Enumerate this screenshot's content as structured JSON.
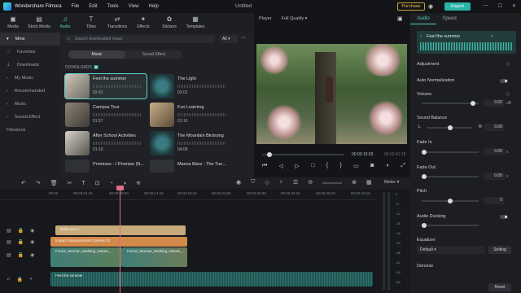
{
  "titlebar": {
    "app": "Wondershare Filmora",
    "menus": [
      "File",
      "Edit",
      "Tools",
      "View",
      "Help"
    ],
    "doc": "Untitled",
    "purchase": "Purchase",
    "export": "Export"
  },
  "media_tabs": [
    {
      "label": "Media",
      "icon": "media-icon"
    },
    {
      "label": "Stock Media",
      "icon": "stock-media-icon"
    },
    {
      "label": "Audio",
      "icon": "audio-icon"
    },
    {
      "label": "Titles",
      "icon": "titles-icon"
    },
    {
      "label": "Transitions",
      "icon": "transitions-icon"
    },
    {
      "label": "Effects",
      "icon": "effects-icon"
    },
    {
      "label": "Stickers",
      "icon": "stickers-icon"
    },
    {
      "label": "Templates",
      "icon": "templates-icon"
    }
  ],
  "sidebar": {
    "items": [
      "Mine",
      "Favorites",
      "Downloads",
      "My Music",
      "Recommended",
      "Music",
      "Sound Effect",
      "Filmstock"
    ]
  },
  "library": {
    "search_placeholder": "Search downloaded music",
    "filter": "All",
    "segments": [
      "Music",
      "Sound Effect"
    ],
    "section": "DOWNLOADS",
    "section_count": "8",
    "tracks": [
      {
        "name": "Feel the summer",
        "dur": "02:41"
      },
      {
        "name": "The Light",
        "dur": "03:01"
      },
      {
        "name": "Campus Tour",
        "dur": "01:57"
      },
      {
        "name": "Fun Learning",
        "dur": "01:16"
      },
      {
        "name": "After School Activities",
        "dur": "01:10"
      },
      {
        "name": "The Mountain Birdsong",
        "dur": "04:08"
      },
      {
        "name": "Promises - I Promise (N...",
        "dur": ""
      },
      {
        "name": "Manos Mars - The Tun...",
        "dur": ""
      }
    ]
  },
  "player": {
    "mode": "Player",
    "quality": "Full Quality",
    "current": "00:00:10:03",
    "total": "00:02:41:15"
  },
  "right": {
    "tabs": [
      "Audio",
      "Speed"
    ],
    "music": "Feel the summer",
    "adjustment": "Adjustment",
    "auto_norm": "Auto Normalization",
    "volume": "Volume",
    "volume_val": "0.00",
    "volume_unit": "dB",
    "balance": "Sound Balance",
    "bal_l": "L",
    "bal_r": "R",
    "balance_val": "0.00",
    "fade_in": "Fade In",
    "fade_in_val": "0.00",
    "fade_in_unit": "s",
    "fade_out": "Fade Out",
    "fade_out_val": "0.00",
    "fade_out_unit": "s",
    "pitch": "Pitch",
    "pitch_val": "0",
    "ducking": "Audio Ducking",
    "equalizer": "Equalizer",
    "eq_value": "Default",
    "eq_setting": "Setting",
    "denoise": "Denoise",
    "reset": "Reset"
  },
  "timeline": {
    "meter": "Meter",
    "ticks": [
      "00:00",
      "00:00:04:25",
      "00:00:09:20",
      "00:00:14:15",
      "00:00:19:10",
      "00:00:24:05",
      "00:00:29:00",
      "00:00:33:25",
      "00:00:38:20",
      "00:00:43:15"
    ],
    "meter_levels": [
      "0",
      "-6",
      "-12",
      "-18",
      "-24",
      "-30",
      "-36",
      "-42",
      "-48",
      "-54"
    ],
    "clips": {
      "title1": "Bullet Box 1",
      "title2": "Impact Announcement Opener 01",
      "video1": "Forest_Woman_Walking_Nature_...",
      "video2": "Forest_Woman_Walking_Nature_...",
      "audio": "Feel the summer"
    }
  },
  "colors": {
    "accent": "#4fd1c5",
    "playhead": "#e36b8b",
    "title_clip": "#c8a97a",
    "overlay_clip": "#d28a4a",
    "video_clip": "#3f7e78"
  }
}
